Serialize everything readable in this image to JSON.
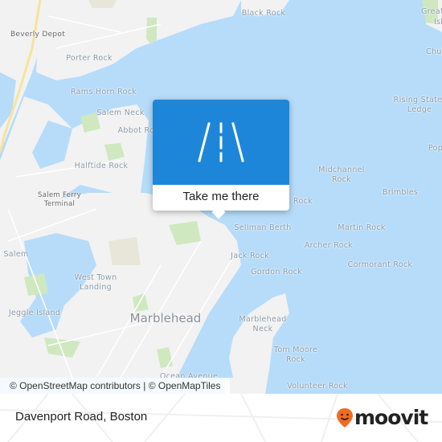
{
  "map": {
    "labels": [
      "Beverly Depot",
      "Porter Rock",
      "Black Rock",
      "Great",
      "Island",
      "Chub",
      "Rams Horn Rock",
      "Salem Neck",
      "Abbot Rock",
      "Halftide Rock",
      "Rising State",
      "Ledge",
      "Pop",
      "Midchannel",
      "Rock",
      "Brimbles",
      "Rock",
      "Salem Ferry",
      "Terminal",
      "Sellman Berth",
      "Martin Rock",
      "Archer Rock",
      "Jack Rock",
      "Gordon Rock",
      "Cormorant Rock",
      "Salem",
      "West Town",
      "Landing",
      "Jeggle Island",
      "Marblehead",
      "Marblehead",
      "Neck",
      "Tom Moore",
      "Rock",
      "Volunteer Rock",
      "Ocean Avenue"
    ],
    "attribution": "© OpenStreetMap contributors | © OpenMapTiles",
    "colors": {
      "water": "#b6dcfa",
      "land": "#f2f2f2",
      "park": "#cfe8c0",
      "popup": "#1e86d9"
    }
  },
  "popup": {
    "icon": "road-icon",
    "action_label": "Take me there"
  },
  "footer": {
    "address": "Davenport Road, Boston",
    "brand": "moovit",
    "brand_color": "#f26b21"
  }
}
